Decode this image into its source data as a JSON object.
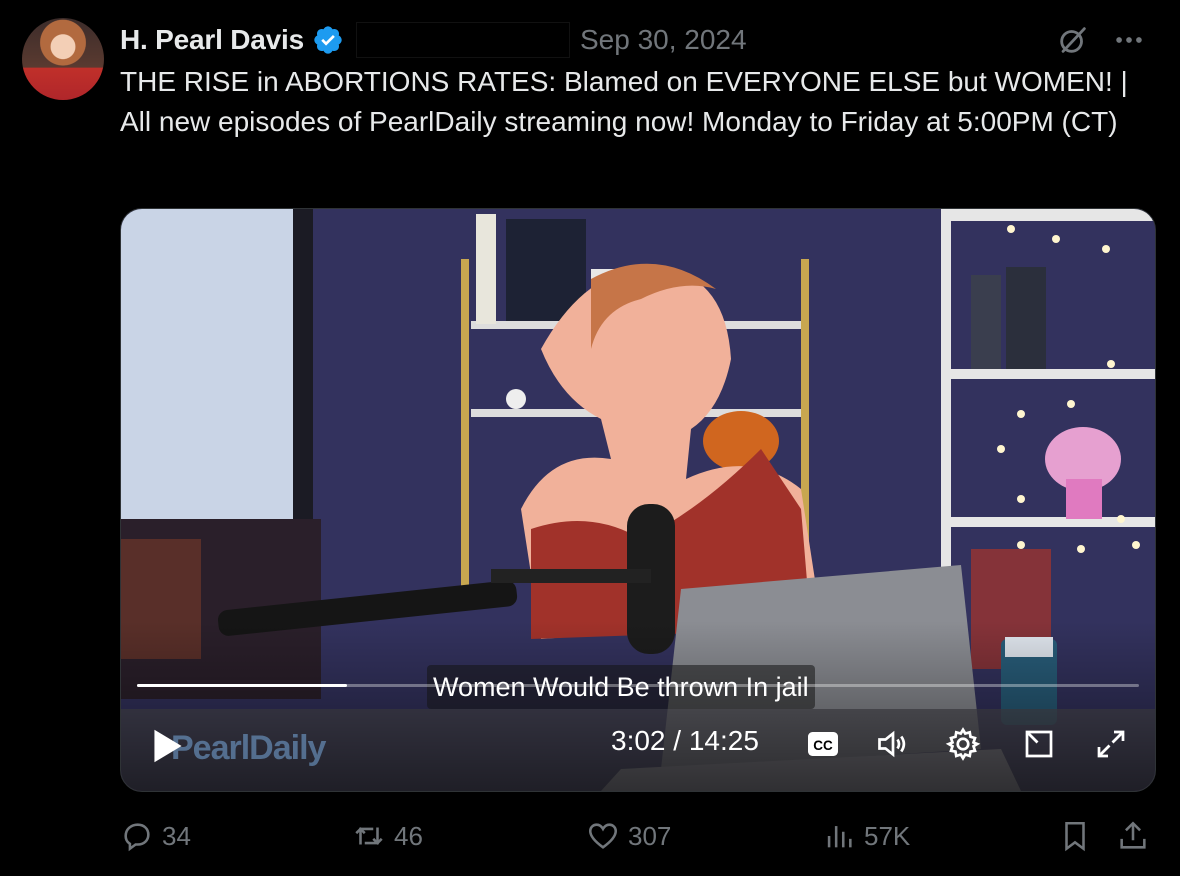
{
  "post": {
    "author_name": "H. Pearl Davis",
    "date": "Sep 30, 2024",
    "text": "THE RISE in ABORTIONS RATES: Blamed on EVERYONE ELSE but WOMEN! | All new episodes of PearlDaily streaming now! Monday to Friday at 5:00PM (CT)"
  },
  "video": {
    "caption": "Women Would Be thrown In jail",
    "time": "3:02 / 14:25",
    "progress_fraction": 0.21,
    "watermark": "PearlDaily"
  },
  "actions": {
    "replies": "34",
    "reposts": "46",
    "likes": "307",
    "views": "57K"
  },
  "colors": {
    "verified": "#1d9bf0",
    "muted_text": "#71767b",
    "primary_text": "#e7e9ea"
  }
}
